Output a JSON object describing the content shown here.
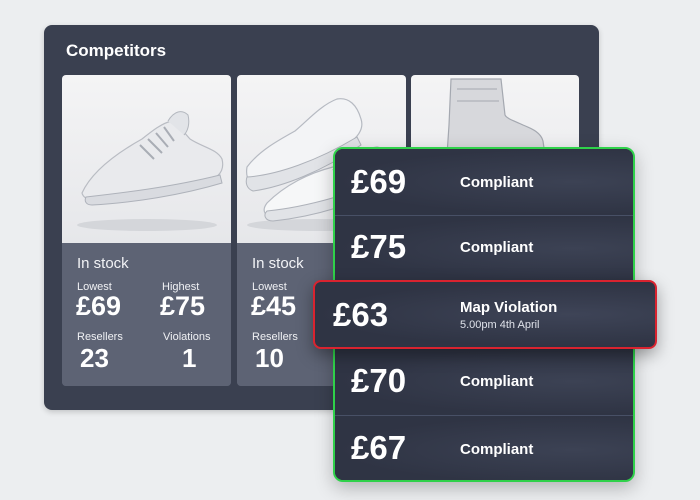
{
  "competitors": {
    "title": "Competitors",
    "products": [
      {
        "image_icon": "sneaker-icon",
        "stock_status": "In stock",
        "lowest_label": "Lowest",
        "lowest_value": "£69",
        "highest_label": "Highest",
        "highest_value": "£75",
        "resellers_label": "Resellers",
        "resellers_value": "23",
        "violations_label": "Violations",
        "violations_value": "1"
      },
      {
        "image_icon": "trainers-pair-icon",
        "stock_status": "In stock",
        "lowest_label": "Lowest",
        "lowest_value": "£45",
        "resellers_label": "Resellers",
        "resellers_value": "10"
      },
      {
        "image_icon": "boot-icon"
      }
    ]
  },
  "price_panel": {
    "border_color": "#2fd14a",
    "rows": [
      {
        "price": "£69",
        "status": "Compliant"
      },
      {
        "price": "£75",
        "status": "Compliant"
      },
      {
        "price": "£63",
        "status": "Map Violation",
        "timestamp": "5.00pm 4th April",
        "border_color": "#d9232f"
      },
      {
        "price": "£70",
        "status": "Compliant"
      },
      {
        "price": "£67",
        "status": "Compliant"
      }
    ]
  }
}
